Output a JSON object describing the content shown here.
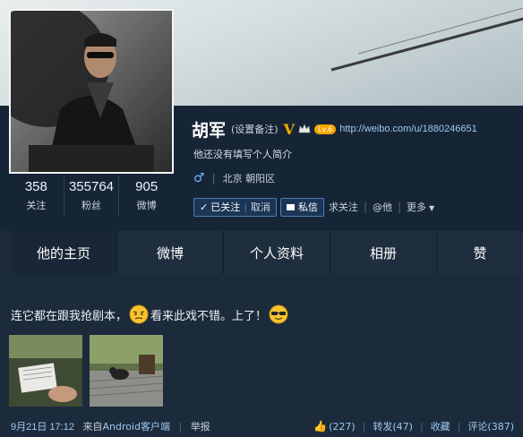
{
  "profile": {
    "name": "胡军",
    "remark": "(设置备注)",
    "verified_mark": "V",
    "level_badge": "Lv.6",
    "url": "http://weibo.com/u/1880246651",
    "intro": "他还没有填写个人简介",
    "gender_icon": "male-icon",
    "location": "北京 朝阳区"
  },
  "counts": [
    {
      "value": "358",
      "label": "关注"
    },
    {
      "value": "355764",
      "label": "粉丝"
    },
    {
      "value": "905",
      "label": "微博"
    }
  ],
  "actions": {
    "followed_label": "已关注",
    "cancel_label": "取消",
    "message_label": "私信",
    "recommend_label": "求关注",
    "mention_label": "@他",
    "more_label": "更多"
  },
  "tabs": [
    {
      "label": "他的主页"
    },
    {
      "label": "微博"
    },
    {
      "label": "个人资料"
    },
    {
      "label": "相册"
    },
    {
      "label": "赞"
    }
  ],
  "post": {
    "text_part1": "连它都在跟我抢剧本，",
    "text_part2": "看来此戏不错。上了！",
    "time": "9月21日 17:12",
    "source_prefix": "来自",
    "source_app": "Android客户端",
    "report": "举报",
    "likes": "(227)",
    "repost": "转发(47)",
    "favorite": "收藏",
    "comment": "评论(387)"
  },
  "colors": {
    "background": "#1c2b3b",
    "accent_link": "#9ec9f2",
    "verified": "#f0b000"
  }
}
